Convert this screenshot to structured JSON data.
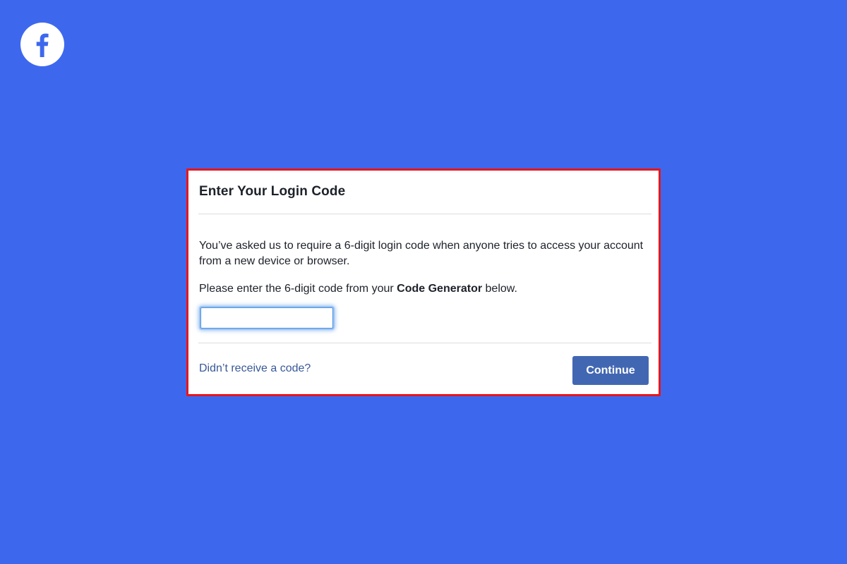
{
  "brand": {
    "logo_icon": "facebook-f-icon",
    "logo_letter": "f",
    "background_color": "#3d68ee",
    "highlight_border_color": "#e8151b"
  },
  "dialog": {
    "title": "Enter Your Login Code",
    "description": "You’ve asked us to require a 6-digit login code when anyone tries to access your account from a new device or browser.",
    "instruction_prefix": "Please enter the 6-digit code from your ",
    "instruction_emphasis": "Code Generator",
    "instruction_suffix": " below.",
    "code_input": {
      "value": "",
      "placeholder": ""
    },
    "resend_link": "Didn’t receive a code?",
    "continue_button": "Continue",
    "button_color": "#4267b2",
    "link_color": "#385898"
  }
}
